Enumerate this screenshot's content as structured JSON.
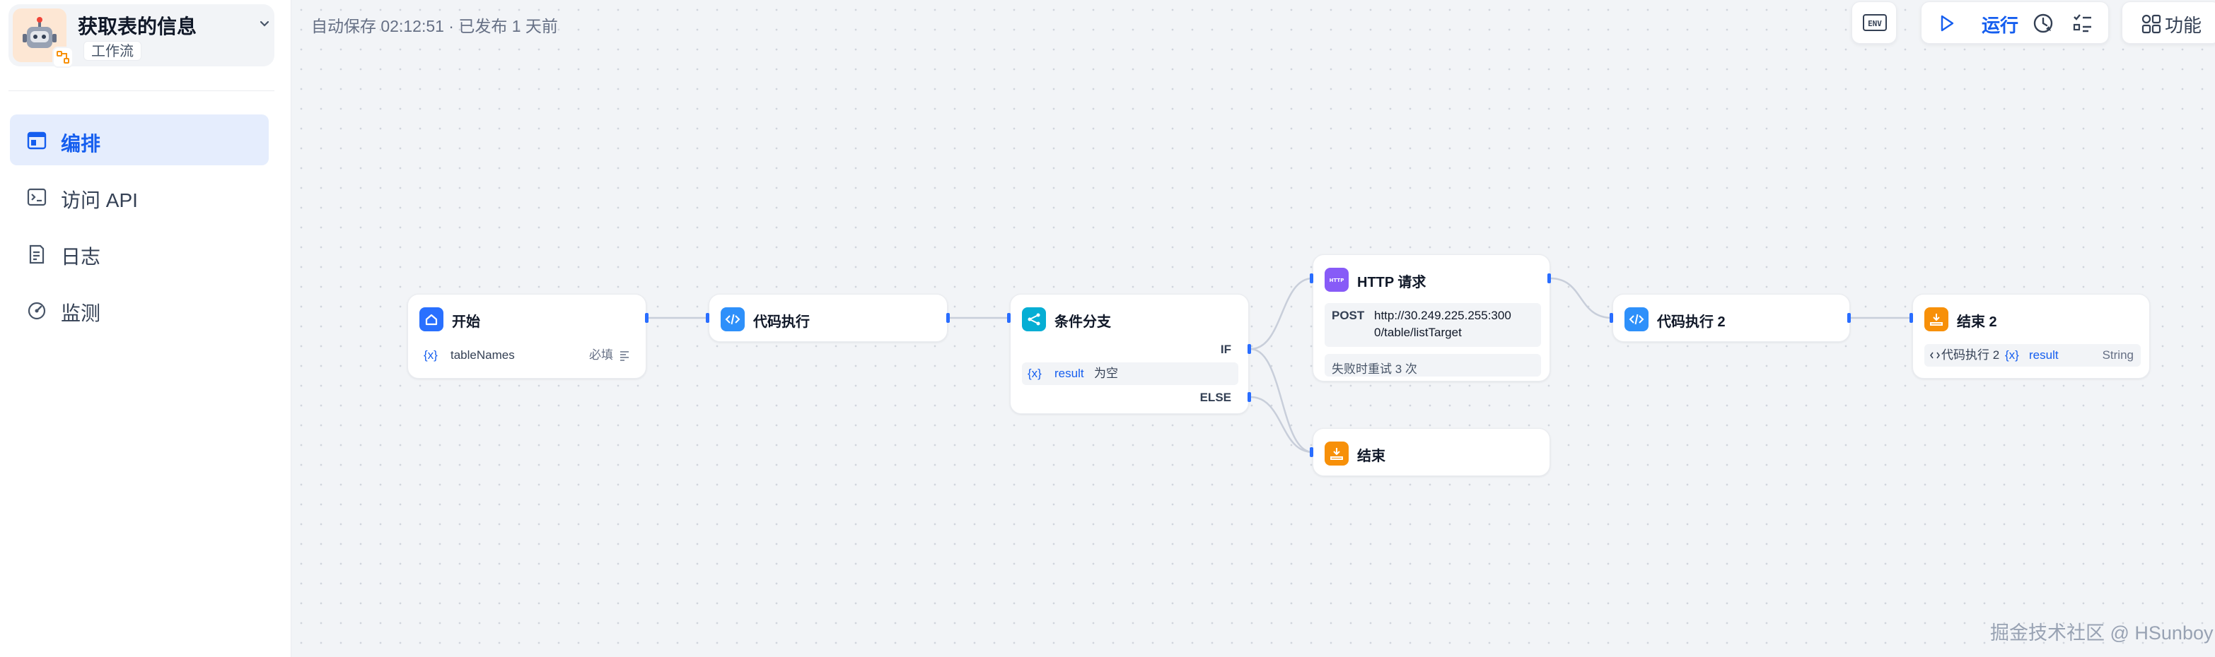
{
  "app": {
    "name": "获取表的信息",
    "type_tag": "工作流"
  },
  "sidebar": {
    "items": [
      {
        "label": "编排",
        "icon": "layout-icon",
        "active": true
      },
      {
        "label": "访问 API",
        "icon": "terminal-icon",
        "active": false
      },
      {
        "label": "日志",
        "icon": "log-icon",
        "active": false
      },
      {
        "label": "监测",
        "icon": "gauge-icon",
        "active": false
      }
    ]
  },
  "canvas": {
    "autosave": "自动保存 02:12:51 · 已发布 1 天前"
  },
  "toolbar": {
    "env_label": "ENV",
    "run_label": "运行",
    "features_label": "功能"
  },
  "nodes": {
    "start": {
      "title": "开始",
      "var_name": "tableNames",
      "required": "必填"
    },
    "code1": {
      "title": "代码执行"
    },
    "ifelse": {
      "title": "条件分支",
      "if_label": "IF",
      "else_label": "ELSE",
      "cond_var": "result",
      "cond_op": "为空"
    },
    "http": {
      "title": "HTTP 请求",
      "method": "POST",
      "url": "http://30.249.225.255:3000/table/listTarget",
      "url_line1": "http://30.249.225.255:300",
      "url_line2": "0/table/listTarget",
      "retry": "失败时重试 3 次"
    },
    "end1": {
      "title": "结束"
    },
    "code2": {
      "title": "代码执行 2"
    },
    "end2": {
      "title": "结束 2",
      "source": "代码执行 2",
      "var": "result",
      "type": "String"
    }
  },
  "colors": {
    "accent": "#155eef",
    "handle": "#296dff",
    "start_icon": "#2970ff",
    "code_icon": "#2e90fa",
    "ifelse_icon": "#06aed4",
    "http_icon": "#875bf7",
    "end_icon": "#f79009"
  },
  "watermark": "掘金技术社区 @ HSunboy"
}
